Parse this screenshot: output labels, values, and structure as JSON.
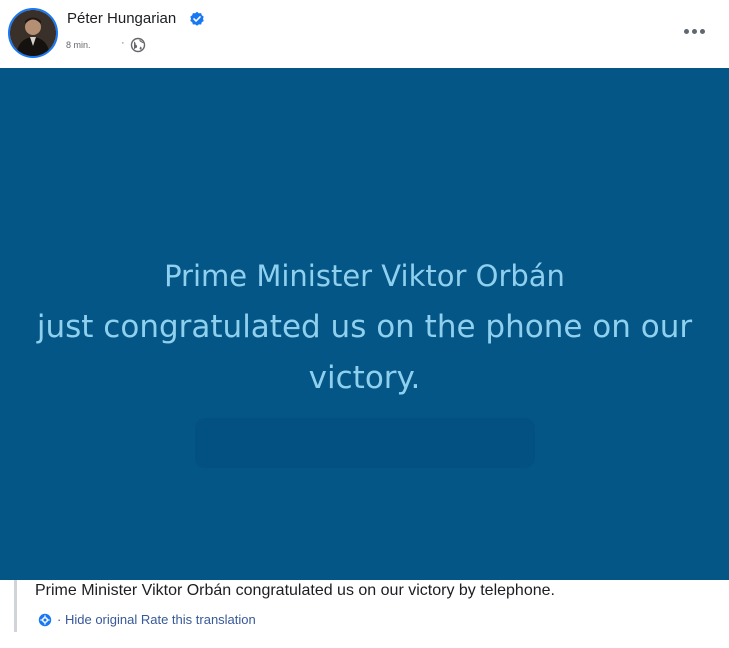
{
  "post": {
    "author": "Péter Hungarian",
    "timestamp": "8 min.",
    "meta_separator": "·",
    "icons": {
      "avatar": "avatar",
      "verified": "verified-badge-icon",
      "privacy": "globe-icon",
      "more": "more-options-icon"
    },
    "colors": {
      "verified": "#1877f2",
      "image_background": "#045687",
      "quote_text": "#8fd0ee",
      "link": "#385898"
    }
  },
  "image": {
    "line1": "Prime Minister Viktor Orbán",
    "line2": "just congratulated us on the phone on our victory."
  },
  "translation": {
    "text": "Prime Minister Viktor Orbán congratulated us on our victory by telephone.",
    "separator": "·",
    "hide_original": "Hide original",
    "rate": "Rate this translation",
    "icon": "translate-settings-icon"
  }
}
